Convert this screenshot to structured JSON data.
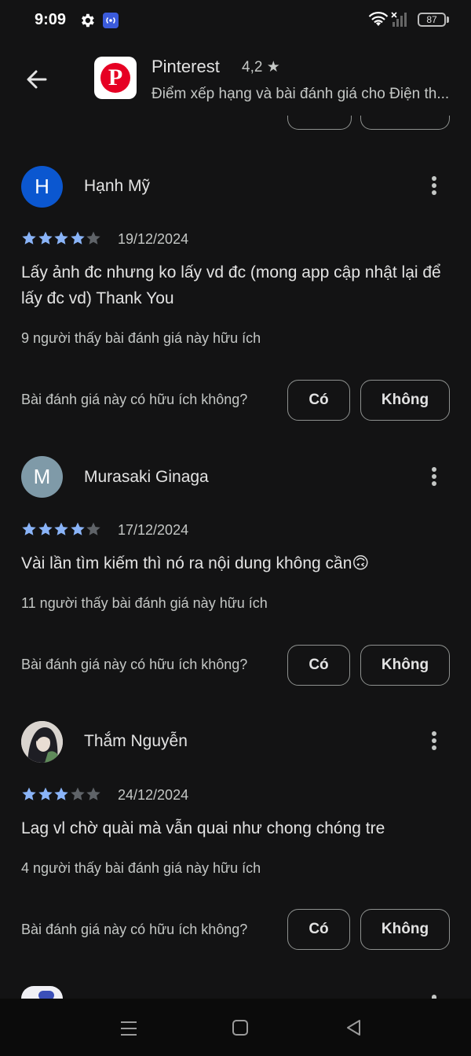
{
  "status_bar": {
    "time": "9:09",
    "battery": "87"
  },
  "app_header": {
    "app_name": "Pinterest",
    "rating": "4,2 ★",
    "subtitle": "Điểm xếp hạng và bài đánh giá cho Điện th..."
  },
  "reviews": [
    {
      "name": "Hạnh Mỹ",
      "avatar_letter": "H",
      "avatar_color": "#0b57d0",
      "stars": 4,
      "date": "19/12/2024",
      "body": "Lấy ảnh đc nhưng ko lấy vd đc (mong app cập nhật lại để lấy đc vd) Thank You",
      "helpful": "9 người thấy bài đánh giá này hữu ích",
      "question": "Bài đánh giá này có hữu ích không?",
      "yes": "Có",
      "no": "Không"
    },
    {
      "name": "Murasaki Ginaga",
      "avatar_letter": "M",
      "avatar_color": "#7f9aa8",
      "stars": 4,
      "date": "17/12/2024",
      "body": "Vài lần tìm kiếm thì nó ra nội dung không cần🙃",
      "helpful": "11 người thấy bài đánh giá này hữu ích",
      "question": "Bài đánh giá này có hữu ích không?",
      "yes": "Có",
      "no": "Không"
    },
    {
      "name": "Thắm Nguyễn",
      "avatar_letter": "",
      "avatar_color": "#d8d4cf",
      "stars": 3,
      "date": "24/12/2024",
      "body": "Lag vl chờ quài mà vẫn quai như chong chóng tre",
      "helpful": "4 người thấy bài đánh giá này hữu ích",
      "question": "Bài đánh giá này có hữu ích không?",
      "yes": "Có",
      "no": "Không"
    }
  ],
  "colors": {
    "background": "#131314",
    "star_filled": "#8ab4f8",
    "star_empty": "#5f6368"
  }
}
